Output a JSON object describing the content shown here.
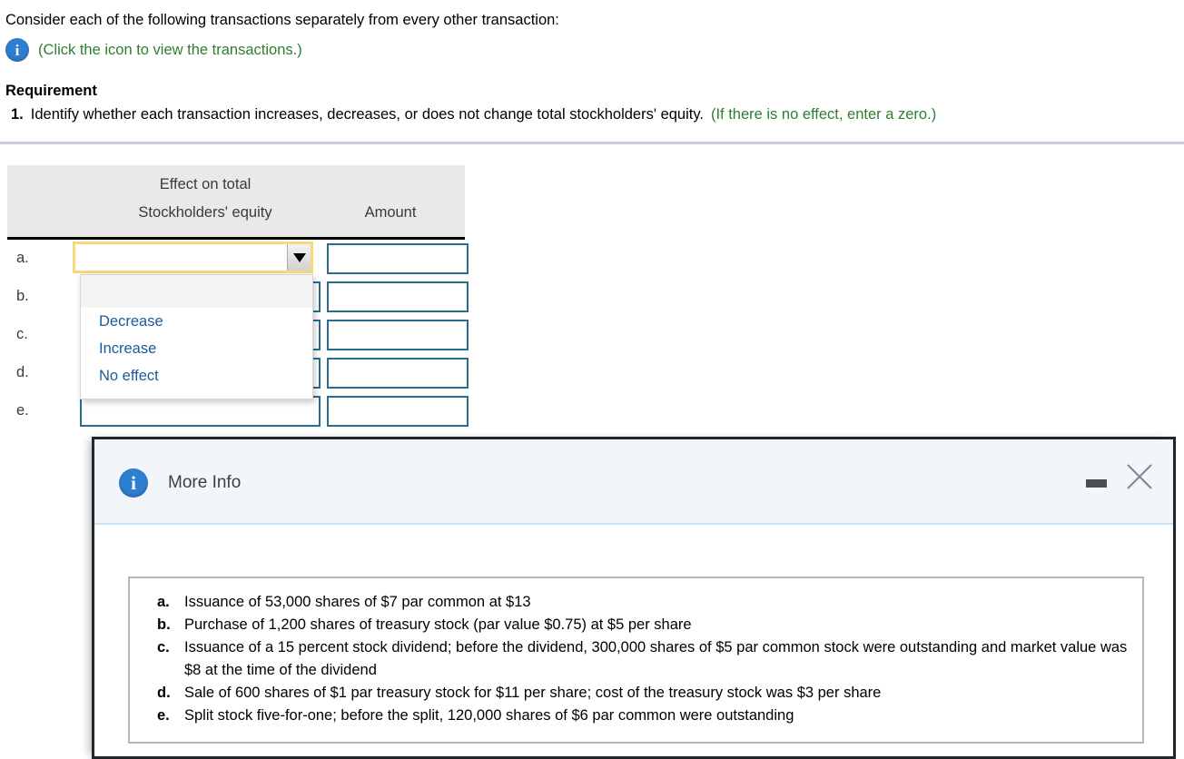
{
  "question": {
    "intro": "Consider each of the following transactions separately from every other transaction:",
    "icon_hint": "(Click the icon to view the transactions.)",
    "info_icon": "info-icon",
    "requirement_heading": "Requirement",
    "requirement_number": "1.",
    "requirement_text": "Identify whether each transaction increases, decreases, or does not change total stockholders' equity.",
    "requirement_hint": "(If there is no effect, enter a zero.)"
  },
  "table": {
    "header_line1": "Effect on total",
    "header_line2": "Stockholders' equity",
    "header_amount": "Amount",
    "rows": [
      {
        "label": "a.",
        "effect": "",
        "amount": ""
      },
      {
        "label": "b.",
        "effect": "",
        "amount": ""
      },
      {
        "label": "c.",
        "effect": "",
        "amount": ""
      },
      {
        "label": "d.",
        "effect": "",
        "amount": ""
      },
      {
        "label": "e.",
        "effect": "",
        "amount": ""
      }
    ]
  },
  "dropdown": {
    "selected": "",
    "options": [
      "",
      "Decrease",
      "Increase",
      "No effect"
    ],
    "option_blank": "",
    "option_decrease": "Decrease",
    "option_increase": "Increase",
    "option_no_effect": "No effect",
    "arrow_icon": "chevron-down-icon"
  },
  "modal": {
    "title": "More Info",
    "info_icon": "info-icon",
    "minimize_label": "minimize-icon",
    "close_label": "close-icon",
    "items": [
      {
        "key": "a.",
        "text": "Issuance of 53,000 shares of $7 par common at $13"
      },
      {
        "key": "b.",
        "text": "Purchase of 1,200 shares of treasury stock (par value $0.75) at $5 per share"
      },
      {
        "key": "c.",
        "text": "Issuance of a 15 percent stock dividend; before the dividend, 300,000 shares of $5 par common stock were outstanding and market value was $8 at the time of the dividend"
      },
      {
        "key": "d.",
        "text": "Sale of 600 shares of $1 par treasury stock for $11 per share; cost of the treasury stock was $3 per share"
      },
      {
        "key": "e.",
        "text": "Split stock five-for-one; before the split, 120,000 shares of $6 par common were outstanding"
      }
    ]
  },
  "colors": {
    "hint_green": "#2f7d32",
    "input_border": "#2b6d8f",
    "focus_yellow": "#f5d97a",
    "option_blue": "#1c5a99",
    "info_blue": "#2f7fd0"
  }
}
